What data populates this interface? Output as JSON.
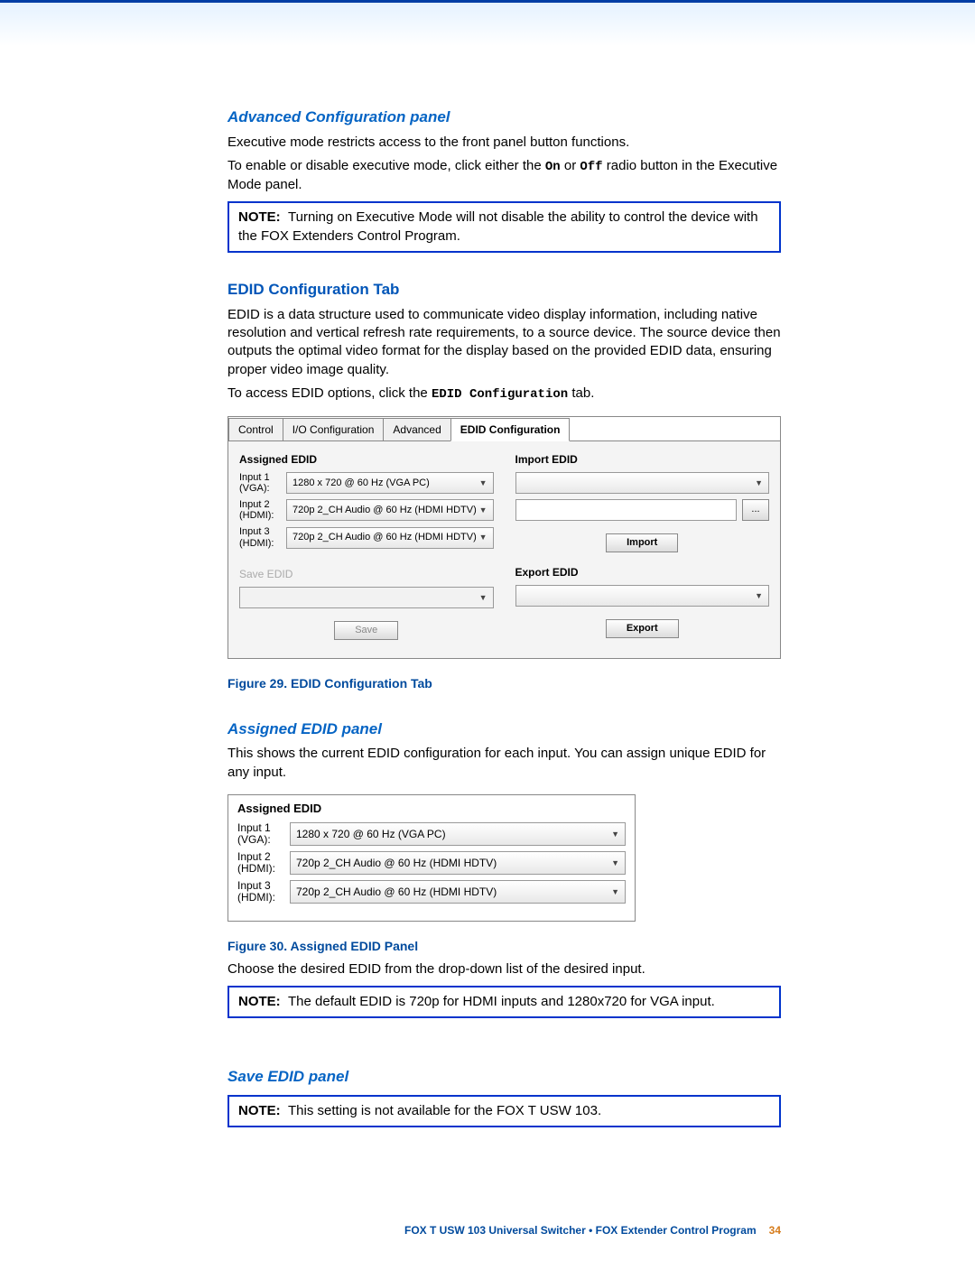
{
  "headings": {
    "advanced": "Advanced Configuration panel",
    "edid_tab": "EDID Configuration Tab",
    "assigned": "Assigned EDID panel",
    "save": "Save EDID panel"
  },
  "paras": {
    "advanced1": "Executive mode restricts access to the front panel button functions.",
    "advanced2a": "To enable or disable executive mode,  click either the ",
    "advanced2_on": "On",
    "advanced2b": " or ",
    "advanced2_off": "Off",
    "advanced2c": " radio button in the Executive Mode panel.",
    "edid1": "EDID is a data structure used to communicate video display information, including native resolution and vertical refresh rate requirements, to a source device. The source device then outputs the optimal video format for the display based on the provided EDID data, ensuring proper video image quality.",
    "edid2a": "To access EDID options, click the ",
    "edid2_mono": "EDID Configuration",
    "edid2b": " tab.",
    "assigned1": "This shows the current EDID configuration for each input. You can assign unique EDID for any input.",
    "assigned2": "Choose the desired EDID from the drop-down list of the desired input."
  },
  "notes": {
    "label": "NOTE:",
    "n1": "Turning on Executive Mode will not disable the ability to control the device with the FOX Extenders Control Program.",
    "n2": "The default EDID is 720p for HDMI inputs and 1280x720 for VGA input.",
    "n3": "This setting is not available for the FOX T USW 103."
  },
  "figures": {
    "f29": "Figure 29.  EDID Configuration Tab",
    "f30": "Figure 30.  Assigned EDID Panel"
  },
  "app": {
    "tabs": [
      "Control",
      "I/O Configuration",
      "Advanced",
      "EDID Configuration"
    ],
    "assigned_title": "Assigned EDID",
    "save_title": "Save EDID",
    "import_title": "Import EDID",
    "export_title": "Export EDID",
    "inputs": [
      {
        "label": "Input 1 (VGA):",
        "value": "1280 x 720 @ 60 Hz (VGA PC)"
      },
      {
        "label": "Input 2 (HDMI):",
        "value": "720p 2_CH Audio @ 60 Hz (HDMI HDTV)"
      },
      {
        "label": "Input 3 (HDMI):",
        "value": "720p 2_CH Audio @ 60 Hz (HDMI HDTV)"
      }
    ],
    "btn_save": "Save",
    "btn_import": "Import",
    "btn_export": "Export",
    "btn_browse": "..."
  },
  "panel2": {
    "title": "Assigned EDID",
    "inputs": [
      {
        "label": "Input 1 (VGA):",
        "value": "1280 x 720 @ 60 Hz (VGA PC)"
      },
      {
        "label": "Input 2 (HDMI):",
        "value": "720p 2_CH Audio @ 60 Hz (HDMI HDTV)"
      },
      {
        "label": "Input 3 (HDMI):",
        "value": "720p 2_CH Audio @ 60 Hz (HDMI HDTV)"
      }
    ]
  },
  "footer": {
    "text": "FOX T USW 103 Universal Switcher • FOX Extender Control Program",
    "page": "34"
  }
}
